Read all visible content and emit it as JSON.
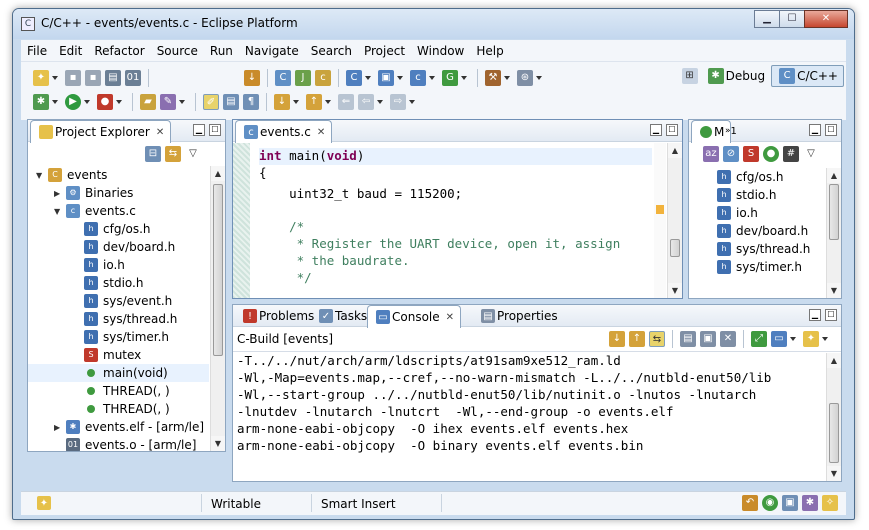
{
  "window": {
    "title": "C/C++ - events/events.c - Eclipse Platform"
  },
  "menu": [
    "File",
    "Edit",
    "Refactor",
    "Source",
    "Run",
    "Navigate",
    "Search",
    "Project",
    "Window",
    "Help"
  ],
  "perspectives": {
    "debug": "Debug",
    "cpp": "C/C++"
  },
  "project_explorer": {
    "tab_label": "Project Explorer",
    "items": [
      {
        "label": "events",
        "icon": "project-folder-icon",
        "indent": 0,
        "toggle": "▼"
      },
      {
        "label": "Binaries",
        "icon": "binaries-icon",
        "indent": 1,
        "toggle": "▶"
      },
      {
        "label": "events.c",
        "icon": "c-file-icon",
        "indent": 1,
        "toggle": "▼"
      },
      {
        "label": "cfg/os.h",
        "icon": "header-include-icon",
        "indent": 2,
        "toggle": ""
      },
      {
        "label": "dev/board.h",
        "icon": "header-include-icon",
        "indent": 2,
        "toggle": ""
      },
      {
        "label": "io.h",
        "icon": "header-include-icon",
        "indent": 2,
        "toggle": ""
      },
      {
        "label": "stdio.h",
        "icon": "header-include-icon",
        "indent": 2,
        "toggle": ""
      },
      {
        "label": "sys/event.h",
        "icon": "header-include-icon",
        "indent": 2,
        "toggle": ""
      },
      {
        "label": "sys/thread.h",
        "icon": "header-include-icon",
        "indent": 2,
        "toggle": ""
      },
      {
        "label": "sys/timer.h",
        "icon": "header-include-icon",
        "indent": 2,
        "toggle": ""
      },
      {
        "label": "mutex",
        "icon": "variable-icon",
        "indent": 2,
        "toggle": ""
      },
      {
        "label": "main(void)",
        "icon": "function-icon",
        "indent": 2,
        "toggle": "",
        "selected": true
      },
      {
        "label": "THREAD(, )",
        "icon": "function-icon",
        "indent": 2,
        "toggle": ""
      },
      {
        "label": "THREAD(, )",
        "icon": "function-icon",
        "indent": 2,
        "toggle": ""
      },
      {
        "label": "events.elf - [arm/le]",
        "icon": "elf-binary-icon",
        "indent": 1,
        "toggle": "▶"
      },
      {
        "label": "events.o - [arm/le]",
        "icon": "object-binary-icon",
        "indent": 1,
        "toggle": ""
      }
    ]
  },
  "editor": {
    "tab_label": "events.c",
    "lines": [
      "int main(void)",
      "{",
      "    uint32_t baud = 115200;",
      "",
      "    /*",
      "     * Register the UART device, open it, assign",
      "     * the baudrate.",
      "     */"
    ]
  },
  "outline": {
    "tab_m": "M",
    "tab_other": "1",
    "items": [
      "cfg/os.h",
      "stdio.h",
      "io.h",
      "dev/board.h",
      "sys/thread.h",
      "sys/timer.h"
    ]
  },
  "bottom_tabs": {
    "problems": "Problems",
    "tasks": "Tasks",
    "console": "Console",
    "properties": "Properties"
  },
  "console": {
    "header": "C-Build [events]",
    "lines": [
      "-T../../nut/arch/arm/ldscripts/at91sam9xe512_ram.ld",
      "-Wl,-Map=events.map,--cref,--no-warn-mismatch -L../../nutbld-enut50/lib",
      "-Wl,--start-group ../../nutbld-enut50/lib/nutinit.o -lnutos -lnutarch",
      "-lnutdev -lnutarch -lnutcrt  -Wl,--end-group -o events.elf",
      "arm-none-eabi-objcopy  -O ihex events.elf events.hex",
      "arm-none-eabi-objcopy  -O binary events.elf events.bin"
    ]
  },
  "status": {
    "mode": "Writable",
    "insert": "Smart Insert"
  }
}
